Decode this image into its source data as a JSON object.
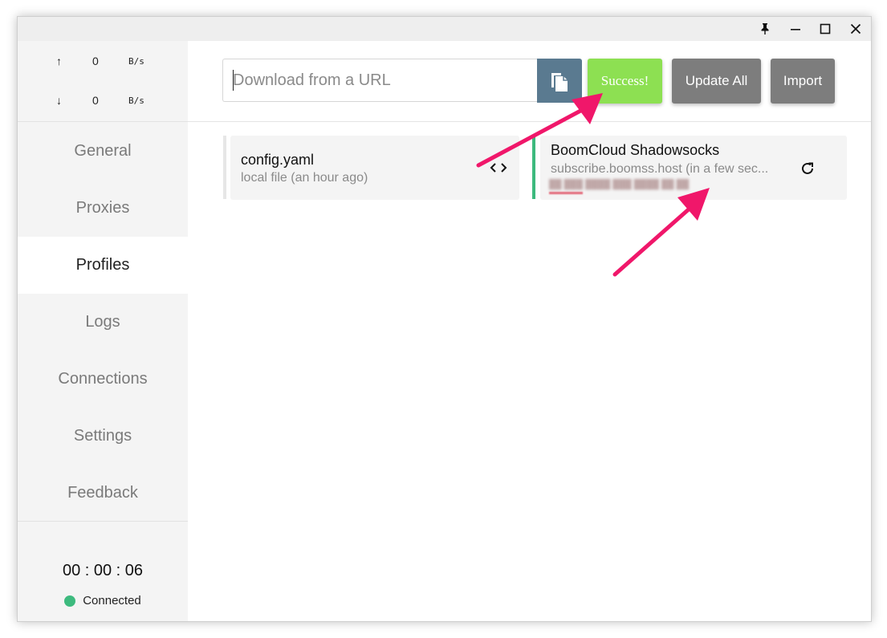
{
  "window_controls": {
    "pin": "pin-icon",
    "minimize": "minimize-icon",
    "maximize": "maximize-icon",
    "close": "close-icon"
  },
  "traffic": {
    "upload": {
      "arrow": "↑",
      "value": "0",
      "unit": "B/s"
    },
    "download": {
      "arrow": "↓",
      "value": "0",
      "unit": "B/s"
    }
  },
  "nav": {
    "items": [
      {
        "label": "General"
      },
      {
        "label": "Proxies"
      },
      {
        "label": "Profiles"
      },
      {
        "label": "Logs"
      },
      {
        "label": "Connections"
      },
      {
        "label": "Settings"
      },
      {
        "label": "Feedback"
      }
    ],
    "active": "Profiles"
  },
  "footer": {
    "timer": "00 : 00 : 06",
    "status": "Connected",
    "status_color": "#3dba7e"
  },
  "toolbar": {
    "url_placeholder": "Download from a URL",
    "url_value": "",
    "paste_icon": "paste-icon",
    "success_label": "Success!",
    "update_all_label": "Update All",
    "import_label": "Import"
  },
  "profiles": [
    {
      "title": "config.yaml",
      "subtitle": "local file (an hour ago)",
      "icon": "edit-code-icon",
      "active": false
    },
    {
      "title": "BoomCloud Shadowsocks",
      "subtitle": "subscribe.boomss.host (in a few sec...",
      "icon": "refresh-icon",
      "active": true,
      "active_color": "#3dba7e"
    }
  ],
  "colors": {
    "accent_green": "#3dba7e",
    "success_button": "#8de052",
    "paste_button": "#5a7a90",
    "secondary_button": "#7d7d7d",
    "annotation_arrow": "#f0176a"
  }
}
